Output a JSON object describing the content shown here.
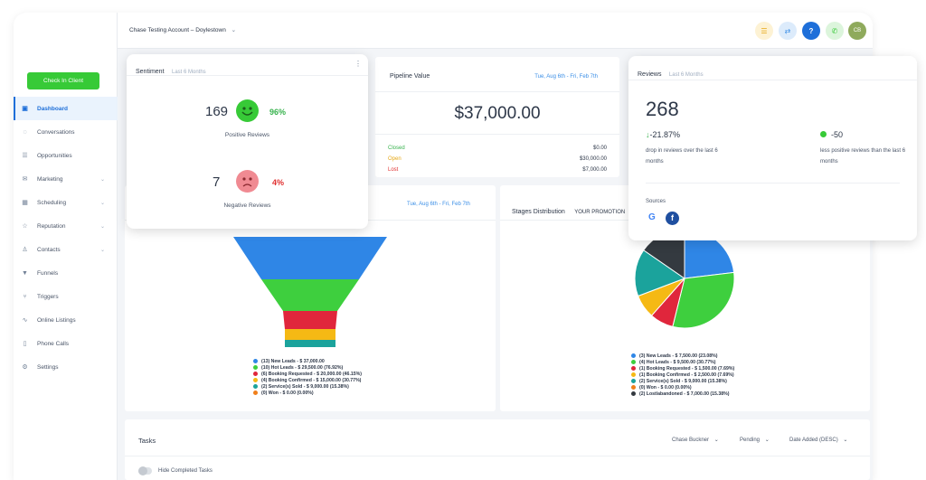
{
  "sidebar": {
    "checkin_label": "Check In Client",
    "items": [
      {
        "label": "Dashboard",
        "icon": "dashboard-icon",
        "glyph": "▣",
        "active": true,
        "chevron": false
      },
      {
        "label": "Conversations",
        "icon": "chat-icon",
        "glyph": "◌",
        "active": false,
        "chevron": false
      },
      {
        "label": "Opportunities",
        "icon": "list-icon",
        "glyph": "☰",
        "active": false,
        "chevron": false
      },
      {
        "label": "Marketing",
        "icon": "mail-icon",
        "glyph": "✉",
        "active": false,
        "chevron": true
      },
      {
        "label": "Scheduling",
        "icon": "calendar-icon",
        "glyph": "▦",
        "active": false,
        "chevron": true
      },
      {
        "label": "Reputation",
        "icon": "star-icon",
        "glyph": "☆",
        "active": false,
        "chevron": true
      },
      {
        "label": "Contacts",
        "icon": "user-icon",
        "glyph": "♙",
        "active": false,
        "chevron": true
      },
      {
        "label": "Funnels",
        "icon": "funnel-icon",
        "glyph": "▼",
        "active": false,
        "chevron": false
      },
      {
        "label": "Triggers",
        "icon": "trigger-icon",
        "glyph": "⑂",
        "active": false,
        "chevron": false
      },
      {
        "label": "Online Listings",
        "icon": "listings-icon",
        "glyph": "∿",
        "active": false,
        "chevron": false
      },
      {
        "label": "Phone Calls",
        "icon": "phone-icon",
        "glyph": "▯",
        "active": false,
        "chevron": false
      },
      {
        "label": "Settings",
        "icon": "gear-icon",
        "glyph": "⚙",
        "active": false,
        "chevron": false
      }
    ]
  },
  "topbar": {
    "account": "Chase Testing Account – Doylestown",
    "avatar_initials": "CB",
    "help_glyph": "?"
  },
  "sentiment": {
    "title": "Sentiment",
    "subtitle": "Last 6 Months",
    "positive_count": "169",
    "positive_pct": "96%",
    "positive_label": "Positive Reviews",
    "negative_count": "7",
    "negative_pct": "4%",
    "negative_label": "Negative Reviews"
  },
  "pipeline": {
    "title": "Pipeline Value",
    "date": "Tue, Aug 6th - Fri, Feb 7th",
    "total": "$37,000.00",
    "rows": [
      {
        "label": "Closed",
        "value": "$0.00",
        "color": "#37b24d"
      },
      {
        "label": "Open",
        "value": "$30,000.00",
        "color": "#e6a817"
      },
      {
        "label": "Lost",
        "value": "$7,000.00",
        "color": "#e03131"
      }
    ]
  },
  "reviews": {
    "title": "Reviews",
    "subtitle": "Last 6 Months",
    "total": "268",
    "change": "-21.87%",
    "change_note": "drop in reviews over the last 6 months",
    "diff": "-50",
    "diff_note": "less positive reviews than the last 6 months",
    "sources_label": "Sources"
  },
  "funnel_card": {
    "date": "Tue, Aug 6th - Fri, Feb 7th"
  },
  "stages_card": {
    "title": "Stages Distribution",
    "pipeline": "YOUR PROMOTION"
  },
  "tasks": {
    "title": "Tasks",
    "assignee": "Chase Buckner",
    "status": "Pending",
    "sort": "Date Added (DESC)",
    "hide_completed": "Hide Completed Tasks"
  },
  "chart_data": [
    {
      "type": "funnel",
      "series": [
        {
          "name": "(13) New Leads - $ 37,000.00",
          "value": 37000,
          "color": "#2f86e6"
        },
        {
          "name": "(10) Hot Leads - $ 29,500.00 (76.92%)",
          "value": 29500,
          "color": "#3ecf3e"
        },
        {
          "name": "(6) Booking Requested - $ 20,000.00 (46.15%)",
          "value": 20000,
          "color": "#e0263c"
        },
        {
          "name": "(4) Booking Confirmed - $ 15,000.00 (30.77%)",
          "value": 15000,
          "color": "#f5b914"
        },
        {
          "name": "(2) Service(s) Sold - $ 9,000.00 (15.38%)",
          "value": 9000,
          "color": "#1ba39c"
        },
        {
          "name": "(0) Won - $ 0.00 (0.00%)",
          "value": 0,
          "color": "#f07f1a"
        }
      ]
    },
    {
      "type": "pie",
      "series": [
        {
          "name": "(3) New Leads - $ 7,500.00 (23.08%)",
          "value": 23.08,
          "color": "#2f86e6"
        },
        {
          "name": "(4) Hot Leads - $ 9,500.00 (30.77%)",
          "value": 30.77,
          "color": "#3ecf3e"
        },
        {
          "name": "(1) Booking Requested - $ 1,500.00 (7.69%)",
          "value": 7.69,
          "color": "#e0263c"
        },
        {
          "name": "(1) Booking Confirmed - $ 2,500.00 (7.69%)",
          "value": 7.69,
          "color": "#f5b914"
        },
        {
          "name": "(2) Service(s) Sold - $ 9,000.00 (15.38%)",
          "value": 15.38,
          "color": "#1ba39c"
        },
        {
          "name": "(0) Won - $ 0.00 (0.00%)",
          "value": 0,
          "color": "#f07f1a"
        },
        {
          "name": "(2) Lost/abandoned - $ 7,000.00 (15.38%)",
          "value": 15.38,
          "color": "#343a40"
        }
      ]
    }
  ]
}
